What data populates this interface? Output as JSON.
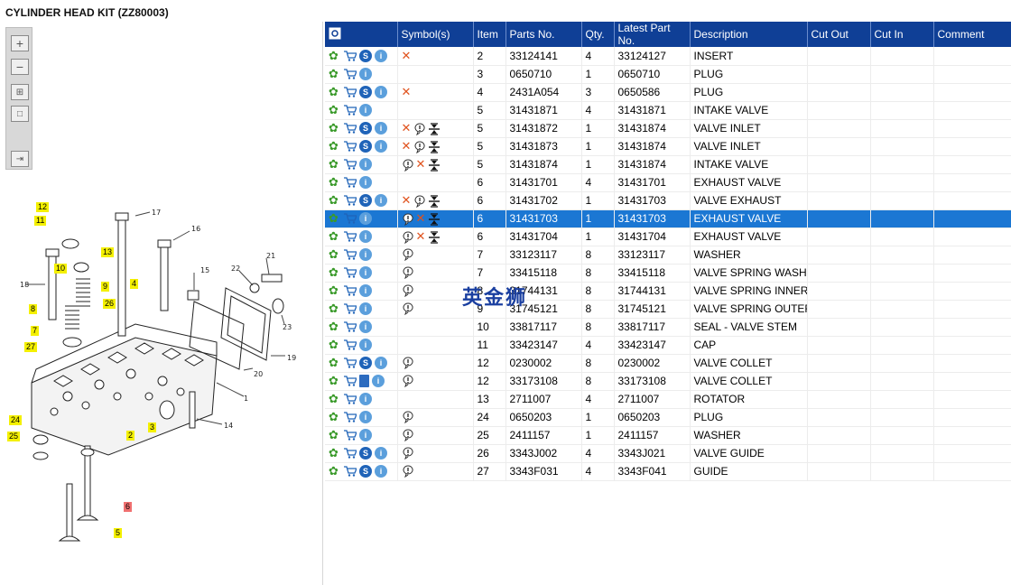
{
  "title": "CYLINDER HEAD KIT (ZZ80003)",
  "columns": [
    "Symbol(s)",
    "Item",
    "Parts No.",
    "Qty.",
    "Latest Part No.",
    "Description",
    "Cut Out",
    "Cut In",
    "Comment"
  ],
  "watermark": "英金狮",
  "rows": [
    {
      "item": "2",
      "part": "33124141",
      "qty": "4",
      "latest": "33124127",
      "desc": "INSERT",
      "s": true,
      "symbols": "x"
    },
    {
      "item": "3",
      "part": "0650710",
      "qty": "1",
      "latest": "0650710",
      "desc": "PLUG",
      "s": false,
      "symbols": ""
    },
    {
      "item": "4",
      "part": "2431A054",
      "qty": "3",
      "latest": "0650586",
      "desc": "PLUG",
      "s": true,
      "symbols": "x"
    },
    {
      "item": "5",
      "part": "31431871",
      "qty": "4",
      "latest": "31431871",
      "desc": "INTAKE VALVE",
      "s": false,
      "symbols": ""
    },
    {
      "item": "5",
      "part": "31431872",
      "qty": "1",
      "latest": "31431874",
      "desc": "VALVE INLET",
      "s": true,
      "symbols": "xbi"
    },
    {
      "item": "5",
      "part": "31431873",
      "qty": "1",
      "latest": "31431874",
      "desc": "VALVE INLET",
      "s": true,
      "symbols": "xbi"
    },
    {
      "item": "5",
      "part": "31431874",
      "qty": "1",
      "latest": "31431874",
      "desc": "INTAKE VALVE",
      "s": false,
      "symbols": "bxi"
    },
    {
      "item": "6",
      "part": "31431701",
      "qty": "4",
      "latest": "31431701",
      "desc": "EXHAUST VALVE",
      "s": false,
      "symbols": ""
    },
    {
      "item": "6",
      "part": "31431702",
      "qty": "1",
      "latest": "31431703",
      "desc": "VALVE EXHAUST",
      "s": true,
      "symbols": "xbi"
    },
    {
      "item": "6",
      "part": "31431703",
      "qty": "1",
      "latest": "31431703",
      "desc": "EXHAUST VALVE",
      "s": false,
      "symbols": "bxi",
      "selected": true
    },
    {
      "item": "6",
      "part": "31431704",
      "qty": "1",
      "latest": "31431704",
      "desc": "EXHAUST VALVE",
      "s": false,
      "symbols": "bxi"
    },
    {
      "item": "7",
      "part": "33123117",
      "qty": "8",
      "latest": "33123117",
      "desc": "WASHER",
      "s": false,
      "symbols": "b"
    },
    {
      "item": "7",
      "part": "33415118",
      "qty": "8",
      "latest": "33415118",
      "desc": "VALVE SPRING WASHER",
      "s": false,
      "symbols": "b"
    },
    {
      "item": "8",
      "part": "31744131",
      "qty": "8",
      "latest": "31744131",
      "desc": "VALVE SPRING INNER",
      "s": false,
      "symbols": "b"
    },
    {
      "item": "9",
      "part": "31745121",
      "qty": "8",
      "latest": "31745121",
      "desc": "VALVE SPRING OUTER",
      "s": false,
      "symbols": "b"
    },
    {
      "item": "10",
      "part": "33817117",
      "qty": "8",
      "latest": "33817117",
      "desc": "SEAL - VALVE STEM",
      "s": false,
      "symbols": ""
    },
    {
      "item": "11",
      "part": "33423147",
      "qty": "4",
      "latest": "33423147",
      "desc": "CAP",
      "s": false,
      "symbols": ""
    },
    {
      "item": "12",
      "part": "0230002",
      "qty": "8",
      "latest": "0230002",
      "desc": "VALVE COLLET",
      "s": true,
      "symbols": "b"
    },
    {
      "item": "12",
      "part": "33173108",
      "qty": "8",
      "latest": "33173108",
      "desc": "VALVE COLLET",
      "s": false,
      "symbols": "b",
      "book": true
    },
    {
      "item": "13",
      "part": "2711007",
      "qty": "4",
      "latest": "2711007",
      "desc": "ROTATOR",
      "s": false,
      "symbols": ""
    },
    {
      "item": "24",
      "part": "0650203",
      "qty": "1",
      "latest": "0650203",
      "desc": "PLUG",
      "s": false,
      "symbols": "b"
    },
    {
      "item": "25",
      "part": "2411157",
      "qty": "1",
      "latest": "2411157",
      "desc": "WASHER",
      "s": false,
      "symbols": "b"
    },
    {
      "item": "26",
      "part": "3343J002",
      "qty": "4",
      "latest": "3343J021",
      "desc": "VALVE GUIDE",
      "s": true,
      "symbols": "b"
    },
    {
      "item": "27",
      "part": "3343F031",
      "qty": "4",
      "latest": "3343F041",
      "desc": "GUIDE",
      "s": true,
      "symbols": "b"
    }
  ],
  "callouts": [
    "12",
    "11",
    "13",
    "10",
    "9",
    "26",
    "8",
    "7",
    "27",
    "4",
    "24",
    "25",
    "3",
    "2",
    "6",
    "5",
    "17",
    "16",
    "15",
    "22",
    "21",
    "18",
    "20",
    "19",
    "23",
    "1",
    "14"
  ]
}
